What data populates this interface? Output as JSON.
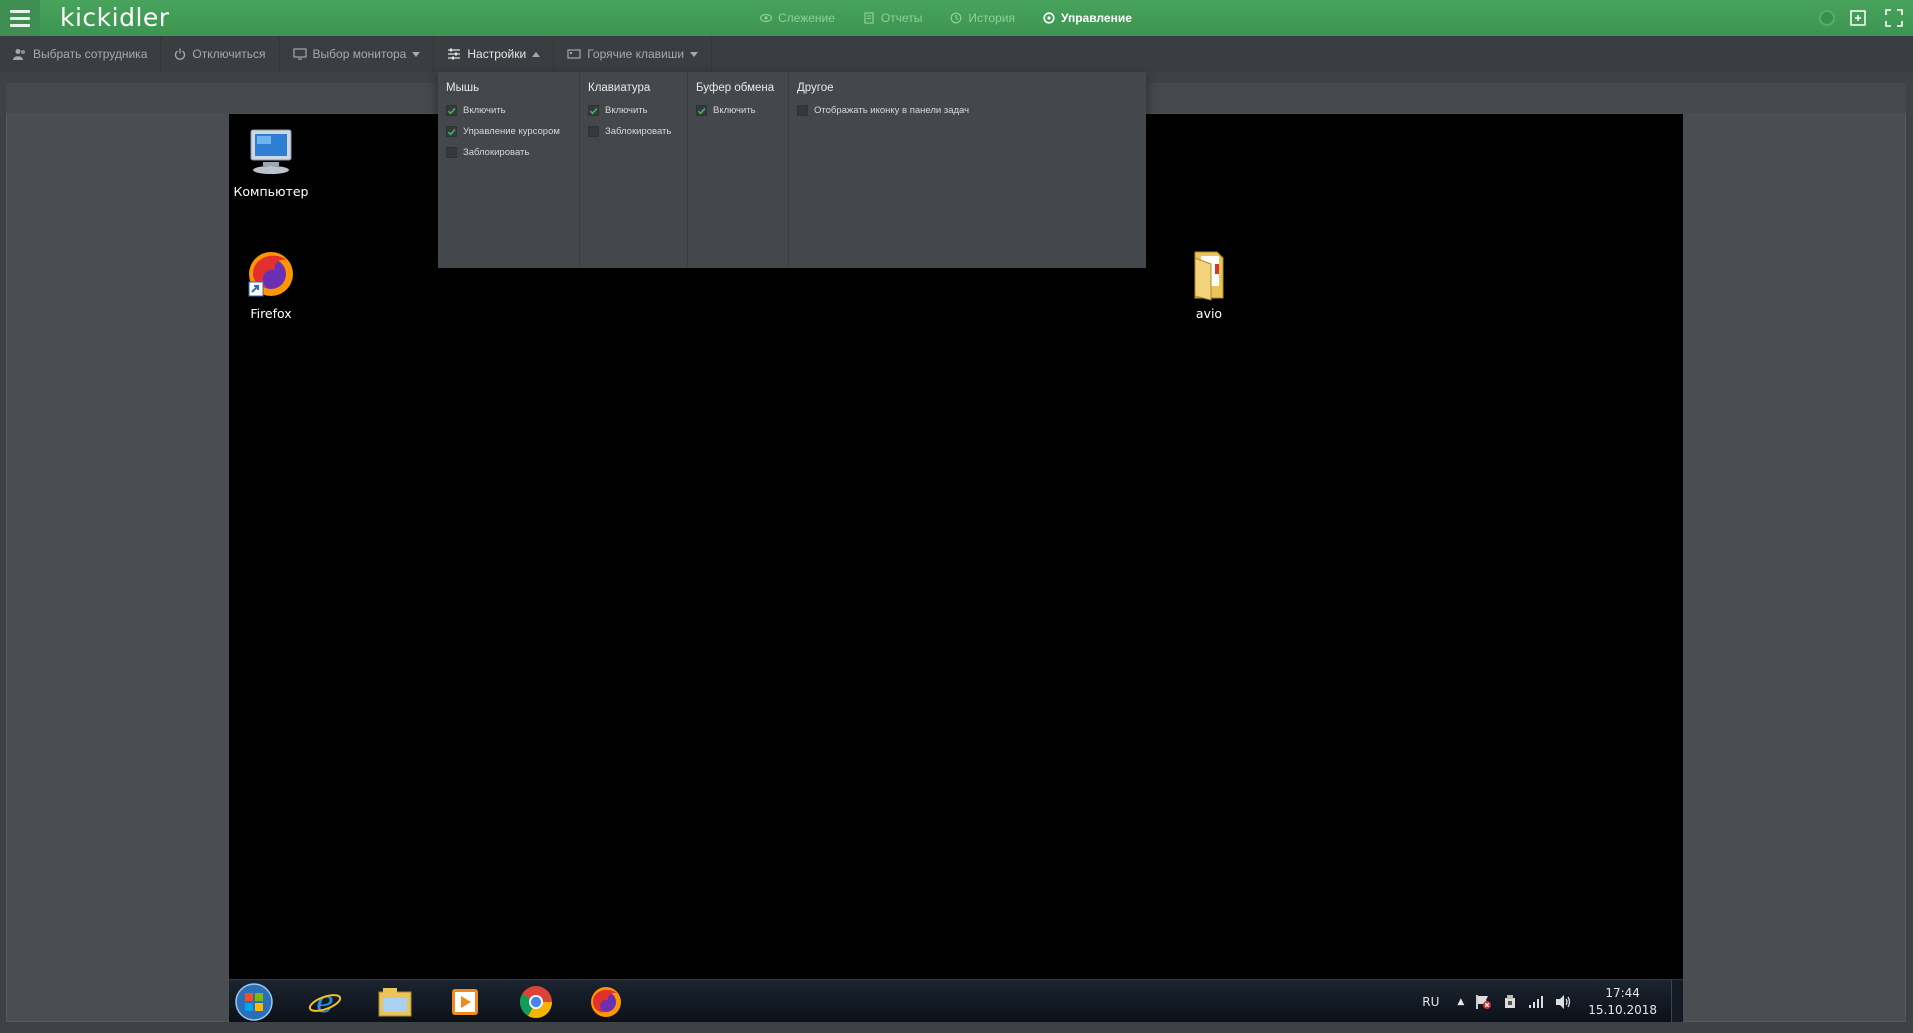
{
  "app": {
    "logo": "kickidler",
    "nav": [
      {
        "label": "Слежение",
        "icon": "eye-icon"
      },
      {
        "label": "Отчеты",
        "icon": "document-icon"
      },
      {
        "label": "История",
        "icon": "history-icon"
      },
      {
        "label": "Управление",
        "icon": "remote-control-icon"
      }
    ],
    "active_nav": "Управление"
  },
  "toolbar": {
    "select_employee": "Выбрать сотрудника",
    "disconnect": "Отключиться",
    "monitor_select": "Выбор монитора",
    "settings": "Настройки",
    "hotkeys": "Горячие клавиши"
  },
  "settings_menu": {
    "mouse": {
      "title": "Мышь",
      "options": [
        {
          "label": "Включить",
          "checked": true
        },
        {
          "label": "Управление курсором",
          "checked": true
        },
        {
          "label": "Заблокировать",
          "checked": false
        }
      ]
    },
    "keyboard": {
      "title": "Клавиатура",
      "options": [
        {
          "label": "Включить",
          "checked": true
        },
        {
          "label": "Заблокировать",
          "checked": false
        }
      ]
    },
    "clipboard": {
      "title": "Буфер обмена",
      "options": [
        {
          "label": "Включить",
          "checked": true
        }
      ]
    },
    "other": {
      "title": "Другое",
      "options": [
        {
          "label": "Отображать иконку в панели задач",
          "checked": false
        }
      ]
    }
  },
  "remote_desktop": {
    "icons": [
      {
        "label": "Компьютер",
        "icon": "computer-icon"
      },
      {
        "label": "Firefox",
        "icon": "firefox-icon"
      },
      {
        "label": "avio",
        "icon": "folder-icon"
      }
    ],
    "taskbar": {
      "apps": [
        "start-orb-icon",
        "internet-explorer-icon",
        "explorer-icon",
        "media-player-icon",
        "chrome-icon",
        "firefox-icon"
      ],
      "language": "RU",
      "time": "17:44",
      "date": "15.10.2018"
    }
  },
  "colors": {
    "accent_green": "#3f9a52",
    "check_green": "#3fb85a",
    "panel": "#44474c"
  }
}
